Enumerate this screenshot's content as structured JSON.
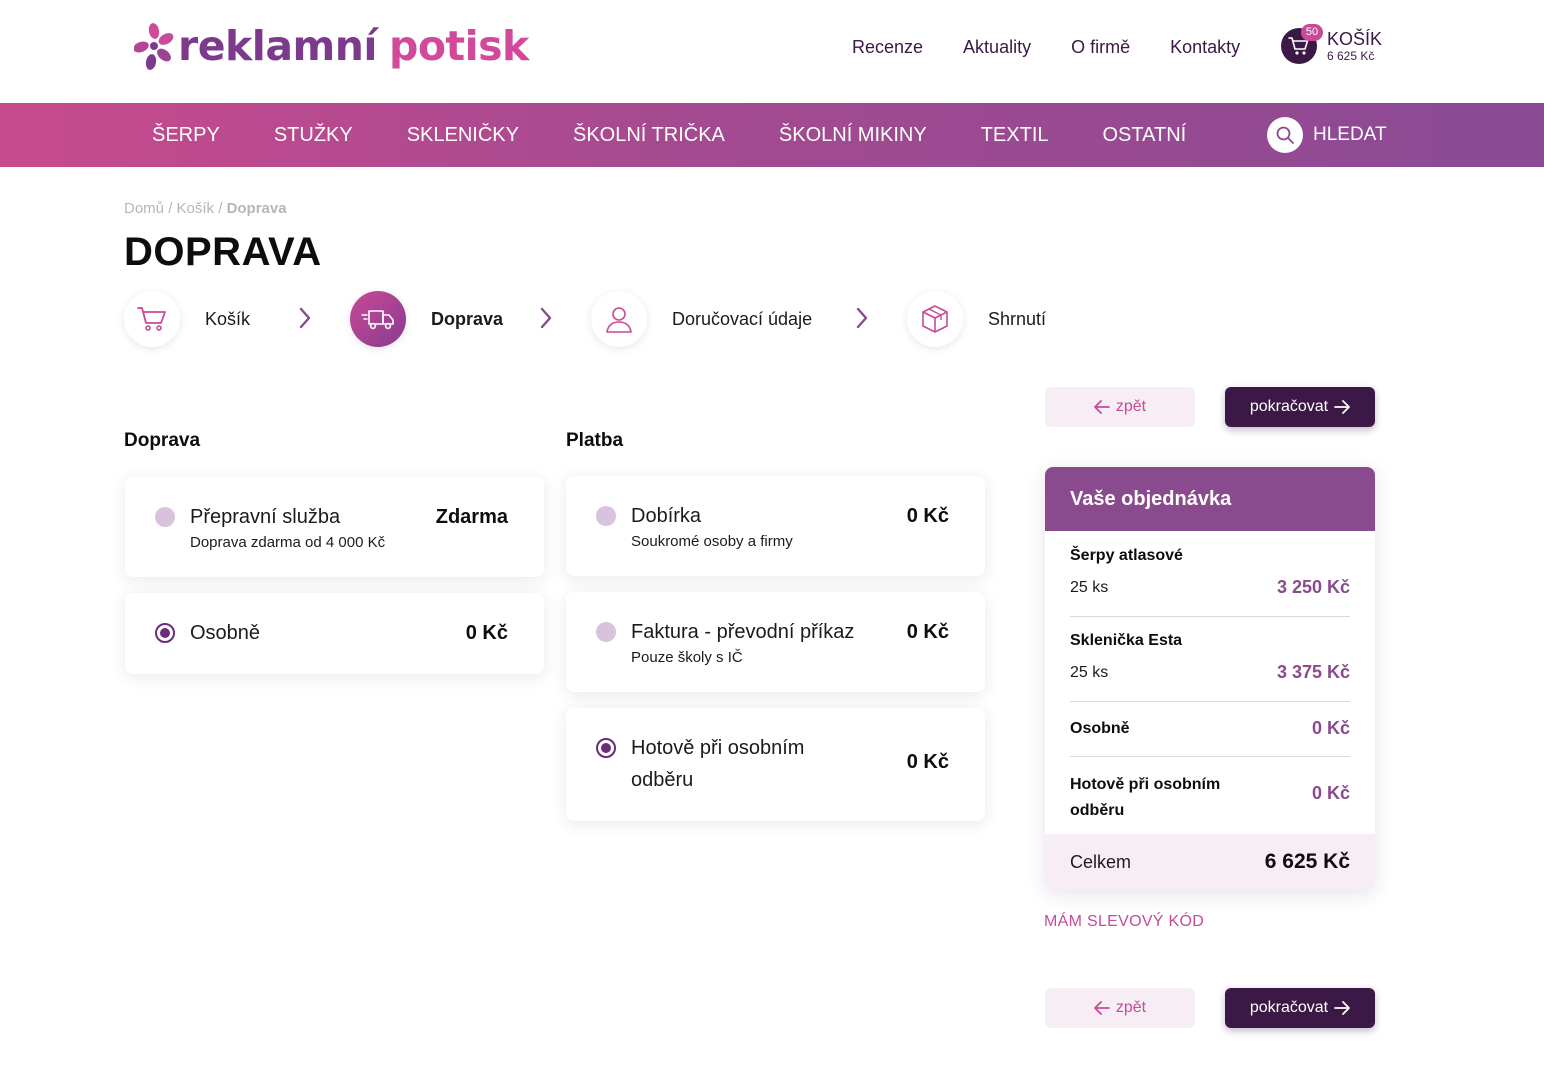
{
  "brand": {
    "logo_word1": "reklamní",
    "logo_word2": "potisk",
    "primary_color": "#3b1846",
    "accent_color": "#c84a98",
    "purple_color": "#8a4a8e"
  },
  "topnav": {
    "items": [
      "Recenze",
      "Aktuality",
      "O firmě",
      "Kontakty"
    ],
    "cart_badge": "50",
    "cart_label": "KOŠÍK",
    "cart_total": "6 625 Kč"
  },
  "mainnav": {
    "items": [
      "ŠERPY",
      "STUŽKY",
      "SKLENIČKY",
      "ŠKOLNÍ TRIČKA",
      "ŠKOLNÍ MIKINY",
      "TEXTIL",
      "OSTATNÍ"
    ],
    "search_label": "HLEDAT"
  },
  "breadcrumb": {
    "home": "Domů",
    "sep": "/",
    "cart": "Košík",
    "current": "Doprava"
  },
  "page_title": "DOPRAVA",
  "steps": [
    {
      "label": "Košík",
      "icon": "cart-icon",
      "active": false
    },
    {
      "label": "Doprava",
      "icon": "truck-icon",
      "active": true
    },
    {
      "label": "Doručovací údaje",
      "icon": "user-icon",
      "active": false
    },
    {
      "label": "Shrnutí",
      "icon": "box-icon",
      "active": false
    }
  ],
  "shipping": {
    "title": "Doprava",
    "options": [
      {
        "name": "Přepravní služba",
        "desc": "Doprava zdarma od 4 000 Kč",
        "price": "Zdarma",
        "selected": false
      },
      {
        "name": "Osobně",
        "desc": "",
        "price": "0 Kč",
        "selected": true
      }
    ]
  },
  "payment": {
    "title": "Platba",
    "options": [
      {
        "name": "Dobírka",
        "desc": "Soukromé osoby a firmy",
        "price": "0 Kč",
        "selected": false
      },
      {
        "name": "Faktura - převodní příkaz",
        "desc": "Pouze školy s IČ",
        "price": "0 Kč",
        "selected": false
      },
      {
        "name_line1": "Hotově při osobním",
        "name_line2": "odběru",
        "price": "0 Kč",
        "selected": true
      }
    ]
  },
  "buttons": {
    "back": "zpět",
    "next": "pokračovat"
  },
  "summary": {
    "title": "Vaše objednávka",
    "items": [
      {
        "name": "Šerpy atlasové",
        "qty": "25 ks",
        "price": "3 250 Kč"
      },
      {
        "name": "Sklenička Esta",
        "qty": "25 ks",
        "price": "3 375 Kč"
      },
      {
        "name": "Osobně",
        "price": "0 Kč"
      },
      {
        "name_line1": "Hotově při osobním",
        "name_line2": "odběru",
        "price": "0 Kč"
      }
    ],
    "total_label": "Celkem",
    "total_value": "6 625 Kč"
  },
  "discount_link": "MÁM SLEVOVÝ KÓD"
}
